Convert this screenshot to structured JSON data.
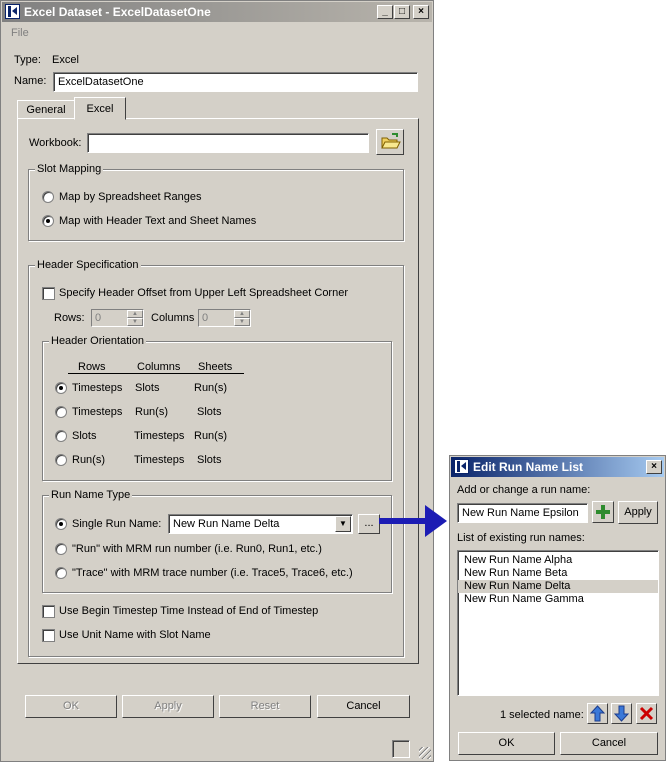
{
  "main_window": {
    "title": "Excel Dataset - ExcelDatasetOne",
    "menu_file": "File",
    "type_label": "Type:",
    "type_value": "Excel",
    "name_label": "Name:",
    "name_value": "ExcelDatasetOne",
    "tabs": [
      {
        "label": "General"
      },
      {
        "label": "Excel"
      }
    ],
    "workbook_label": "Workbook:",
    "workbook_value": "",
    "slot_mapping": {
      "title": "Slot Mapping",
      "option1": "Map by Spreadsheet Ranges",
      "option2": "Map with Header Text and Sheet Names",
      "selected": 2
    },
    "header_spec": {
      "title": "Header Specification",
      "offset_check": "Specify Header Offset from Upper Left Spreadsheet Corner",
      "rows_label": "Rows:",
      "rows_value": "0",
      "columns_label": "Columns",
      "columns_value": "0"
    },
    "header_orientation": {
      "title": "Header Orientation",
      "col_headers": [
        "Rows",
        "Columns",
        "Sheets"
      ],
      "rows": [
        [
          "Timesteps",
          "Slots",
          "Run(s)"
        ],
        [
          "Timesteps",
          "Run(s)",
          "Slots"
        ],
        [
          "Slots",
          "Timesteps",
          "Run(s)"
        ],
        [
          "Run(s)",
          "Timesteps",
          "Slots"
        ]
      ],
      "selected_index": 0
    },
    "run_name_type": {
      "title": "Run Name Type",
      "single_label": "Single Run Name:",
      "single_value": "New Run Name Delta",
      "ellipsis": "...",
      "run_option": "\"Run\" with MRM run number (i.e. Run0, Run1, etc.)",
      "trace_option": "\"Trace\" with MRM trace number (i.e. Trace5, Trace6, etc.)"
    },
    "begin_timestep_check": "Use Begin Timestep Time Instead of End of Timestep",
    "unit_name_check": "Use Unit Name with Slot Name",
    "buttons": {
      "ok": "OK",
      "apply": "Apply",
      "reset": "Reset",
      "cancel": "Cancel"
    }
  },
  "edit_dialog": {
    "title": "Edit Run Name List",
    "add_label": "Add or change a run name:",
    "input_value": "New Run Name Epsilon",
    "apply": "Apply",
    "list_label": "List of existing run names:",
    "items": [
      "New Run Name Alpha",
      "New Run Name Beta",
      "New Run Name Delta",
      "New Run Name Gamma"
    ],
    "selected_index": 2,
    "selected_count": "1 selected name:",
    "ok": "OK",
    "cancel": "Cancel"
  },
  "colors": {
    "accent": "#0a246a",
    "arrow": "#1c1cb4",
    "add_icon": "#2e8b2e",
    "delete_icon": "#cc0000",
    "move_icon": "#3a78d8"
  }
}
